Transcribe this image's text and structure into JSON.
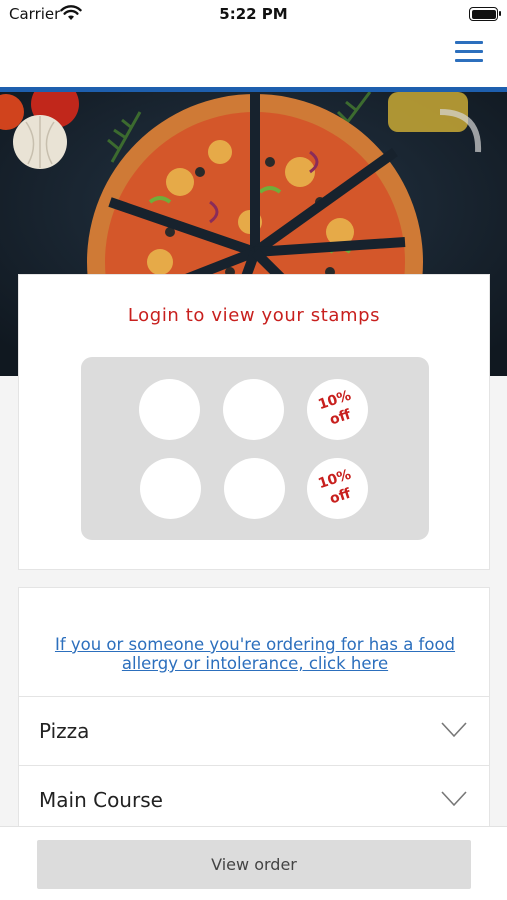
{
  "status_bar": {
    "carrier": "Carrier",
    "time": "5:22 PM"
  },
  "nav": {
    "menu_icon": "hamburger-menu-icon",
    "accent_color": "#2c6fbd",
    "border_color": "#1e5fae"
  },
  "hero": {
    "image_subject": "pizza on dark table"
  },
  "stamps": {
    "title": "Login to view your stamps",
    "title_color": "#c8201e",
    "slots": [
      {
        "reward": ""
      },
      {
        "reward": ""
      },
      {
        "reward": "10%\noff"
      },
      {
        "reward": ""
      },
      {
        "reward": ""
      },
      {
        "reward": "10%\noff"
      }
    ]
  },
  "allergy": {
    "link_text": "If you or someone you're ordering for has a food allergy or intolerance, click here"
  },
  "categories": [
    {
      "label": "Pizza",
      "icon": "chevron-down-icon"
    },
    {
      "label": "Main Course",
      "icon": "chevron-down-icon"
    }
  ],
  "footer": {
    "view_order_label": "View order"
  }
}
